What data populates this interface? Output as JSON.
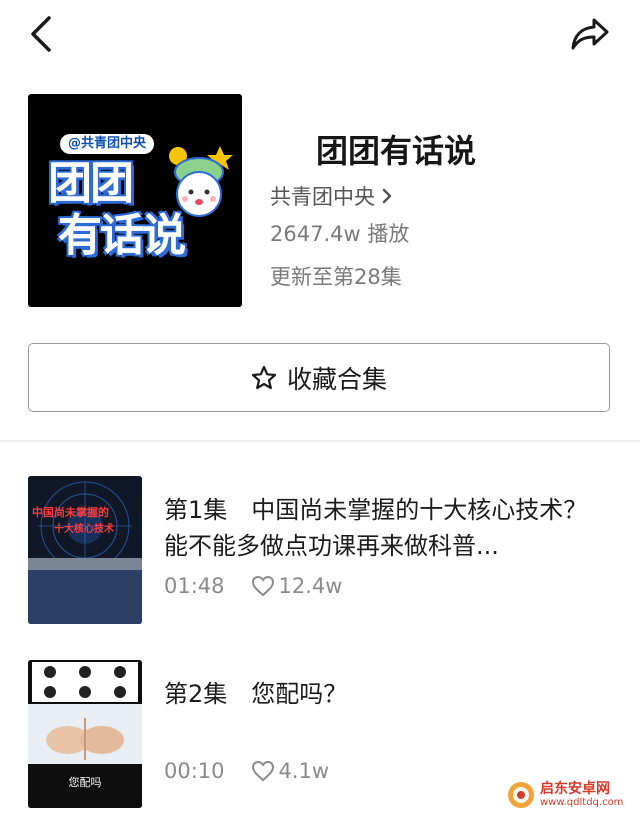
{
  "header": {
    "back_icon": "chevron-left-icon",
    "share_icon": "share-arrow-icon"
  },
  "collection": {
    "cover_brand": "@共青团中央",
    "cover_line1": "团团",
    "cover_line2": "有话说",
    "title": "团团有话说",
    "author": "共青团中央",
    "plays": "2647.4w 播放",
    "update": "更新至第28集"
  },
  "favorite_button": {
    "label": "收藏合集",
    "icon": "star-outline-icon"
  },
  "episodes": [
    {
      "title": "第1集　中国尚未掌握的十大核心技术？能不能多做点功课再来做科普...",
      "duration": "01:48",
      "likes": "12.4w",
      "thumb_text_1": "中国尚未掌握的",
      "thumb_text_2": "十大核心技术"
    },
    {
      "title": "第2集　您配吗？",
      "duration": "00:10",
      "likes": "4.1w",
      "thumb_caption": "您配吗"
    }
  ],
  "watermark": {
    "name": "启东安卓网",
    "url": "www.qdltdq.com"
  },
  "colors": {
    "accent_blue": "#2d6bd8",
    "text_primary": "#1a1a1a",
    "text_secondary": "#8a8a8a",
    "watermark": "#d63a2a"
  }
}
